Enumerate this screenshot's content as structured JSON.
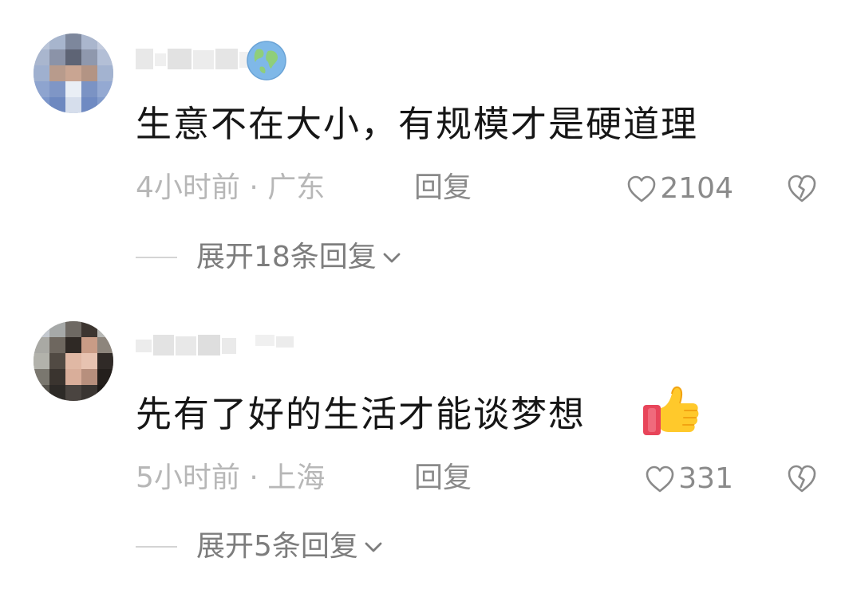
{
  "comments": [
    {
      "text": "生意不在大小，有规模才是硬道理",
      "meta": "4小时前 · 广东",
      "reply_label": "回复",
      "likes": "2104",
      "expand_label": "展开18条回复"
    },
    {
      "text": "先有了好的生活才能谈梦想",
      "meta": "5小时前 · 上海",
      "reply_label": "回复",
      "likes": "331",
      "expand_label": "展开5条回复"
    }
  ],
  "icons": {
    "like": "heart-outline-icon",
    "dislike": "broken-heart-icon",
    "expand": "chevron-down-icon",
    "badge": "globe-icon",
    "reaction": "thumbs-up-icon"
  },
  "colors": {
    "text_primary": "#161616",
    "text_meta": "#b7b7b7",
    "text_secondary": "#8a8a8a"
  }
}
